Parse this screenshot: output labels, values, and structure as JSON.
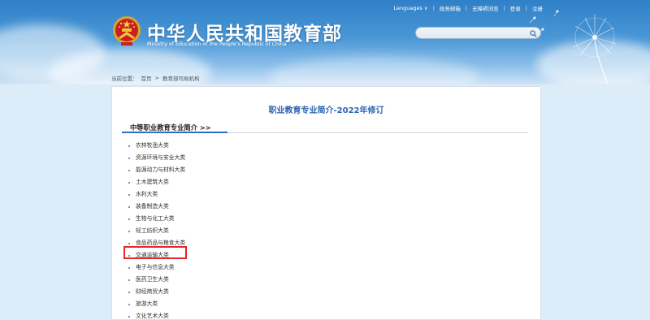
{
  "header": {
    "title": "中华人民共和国教育部",
    "subtitle": "Ministry of Education of the People's Republic of China",
    "topnav": [
      "Languages ∨",
      "政务邮箱",
      "无障碍浏览",
      "登录",
      "注册"
    ],
    "search": {
      "placeholder": ""
    }
  },
  "breadcrumb": [
    "当前位置：",
    "首页",
    ">",
    "教育部司局机构"
  ],
  "page": {
    "title": "职业教育专业简介-2022年修订",
    "section": "中等职业教育专业简介 >>"
  },
  "categories": [
    "农林牧渔大类",
    "资源环境与安全大类",
    "能源动力与材料大类",
    "土木建筑大类",
    "水利大类",
    "装备制造大类",
    "生物与化工大类",
    "轻工纺织大类",
    "食品药品与粮食大类",
    "交通运输大类",
    "电子与信息大类",
    "医药卫生大类",
    "财经商贸大类",
    "旅游大类",
    "文化艺术大类"
  ],
  "highlighted_index": 9,
  "colors": {
    "accent": "#2c63b5",
    "highlight_box": "#e8262a",
    "banner": "#2f80c8"
  }
}
